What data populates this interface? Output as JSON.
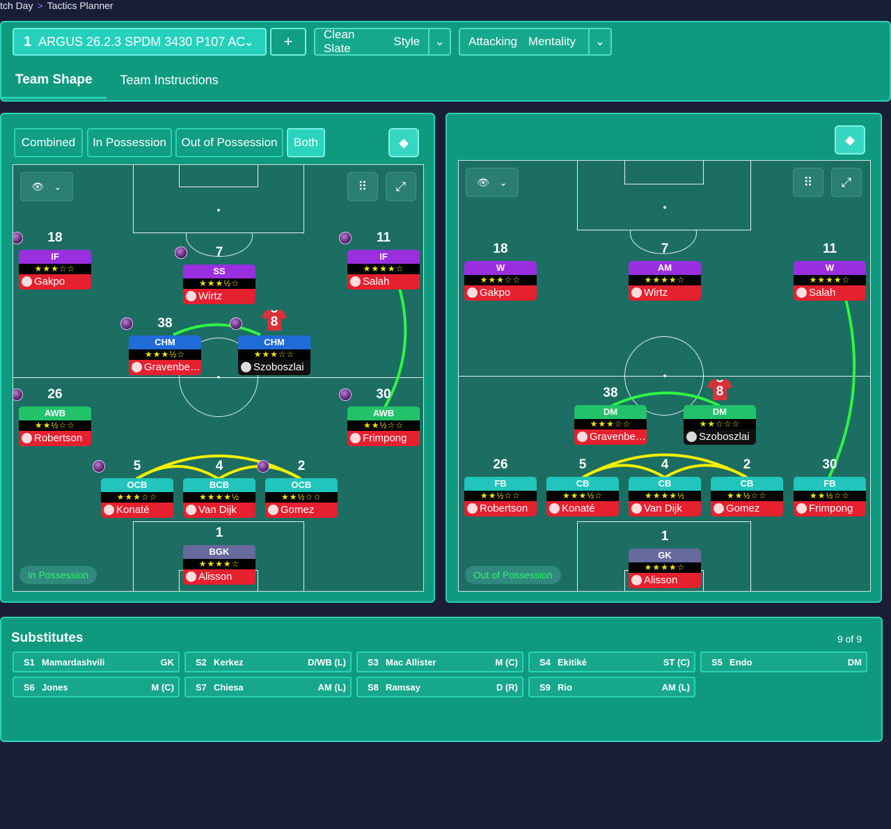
{
  "breadcrumb": {
    "parent": "tch Day",
    "current": "Tactics Planner"
  },
  "topbar": {
    "tactic_number": "1",
    "tactic_name": "ARGUS 26.2.3 SPDM 3430 P107 AC",
    "plus": "+",
    "style_a": "Clean Slate",
    "style_b": "Style",
    "mentality_a": "Attacking",
    "mentality_b": "Mentality"
  },
  "tabs": [
    "Team Shape",
    "Team Instructions"
  ],
  "view_segments": [
    "Combined",
    "In Possession",
    "Out of Possession",
    "Both"
  ],
  "left_label": "In Possession",
  "right_label": "Out of Possession",
  "left_players": [
    {
      "num": "18",
      "role": "IF",
      "stars": "★★★☆☆",
      "name": "Gakpo"
    },
    {
      "num": "7",
      "role": "SS",
      "stars": "★★★½☆",
      "name": "Wirtz"
    },
    {
      "num": "11",
      "role": "IF",
      "stars": "★★★★☆",
      "name": "Salah"
    },
    {
      "num": "38",
      "role": "CHM",
      "stars": "★★★½☆",
      "name": "Gravenber..."
    },
    {
      "num": "8",
      "role": "CHM",
      "stars": "★★★☆☆",
      "name": "Szoboszlai"
    },
    {
      "num": "26",
      "role": "AWB",
      "stars": "★★½☆☆",
      "name": "Robertson"
    },
    {
      "num": "30",
      "role": "AWB",
      "stars": "★★½☆☆",
      "name": "Frimpong"
    },
    {
      "num": "5",
      "role": "OCB",
      "stars": "★★★☆☆",
      "name": "Konaté"
    },
    {
      "num": "4",
      "role": "BCB",
      "stars": "★★★★½",
      "name": "Van Dijk"
    },
    {
      "num": "2",
      "role": "OCB",
      "stars": "★★½☆☆",
      "name": "Gomez"
    },
    {
      "num": "1",
      "role": "BGK",
      "stars": "★★★★☆",
      "name": "Alisson"
    }
  ],
  "right_players": [
    {
      "num": "18",
      "role": "W",
      "stars": "★★★☆☆",
      "name": "Gakpo"
    },
    {
      "num": "7",
      "role": "AM",
      "stars": "★★★★☆",
      "name": "Wirtz"
    },
    {
      "num": "11",
      "role": "W",
      "stars": "★★★★☆",
      "name": "Salah"
    },
    {
      "num": "38",
      "role": "DM",
      "stars": "★★★☆☆",
      "name": "Gravenber..."
    },
    {
      "num": "8",
      "role": "DM",
      "stars": "★★☆☆☆",
      "name": "Szoboszlai"
    },
    {
      "num": "26",
      "role": "FB",
      "stars": "★★½☆☆",
      "name": "Robertson"
    },
    {
      "num": "5",
      "role": "CB",
      "stars": "★★★½☆",
      "name": "Konaté"
    },
    {
      "num": "4",
      "role": "CB",
      "stars": "★★★★½",
      "name": "Van Dijk"
    },
    {
      "num": "2",
      "role": "CB",
      "stars": "★★½☆☆",
      "name": "Gomez"
    },
    {
      "num": "30",
      "role": "FB",
      "stars": "★★½☆☆",
      "name": "Frimpong"
    },
    {
      "num": "1",
      "role": "GK",
      "stars": "★★★★☆",
      "name": "Alisson"
    }
  ],
  "subs": {
    "title": "Substitutes",
    "count": "9 of 9",
    "items": [
      {
        "slot": "S1",
        "name": "Mamardashvili",
        "pos": "GK"
      },
      {
        "slot": "S2",
        "name": "Kerkez",
        "pos": "D/WB (L)"
      },
      {
        "slot": "S3",
        "name": "Mac Allister",
        "pos": "M (C)"
      },
      {
        "slot": "S4",
        "name": "Ekitiké",
        "pos": "ST (C)"
      },
      {
        "slot": "S5",
        "name": "Endo",
        "pos": "DM"
      },
      {
        "slot": "S6",
        "name": "Jones",
        "pos": "M (C)"
      },
      {
        "slot": "S7",
        "name": "Chiesa",
        "pos": "AM (L)"
      },
      {
        "slot": "S8",
        "name": "Ramsay",
        "pos": "D (R)"
      },
      {
        "slot": "S9",
        "name": "Rio",
        "pos": "AM (L)"
      }
    ]
  },
  "colors": {
    "accent": "#2bd3b3",
    "panel": "#0f9a80",
    "pitch": "#1c6e62",
    "background": "#1a1d38"
  }
}
